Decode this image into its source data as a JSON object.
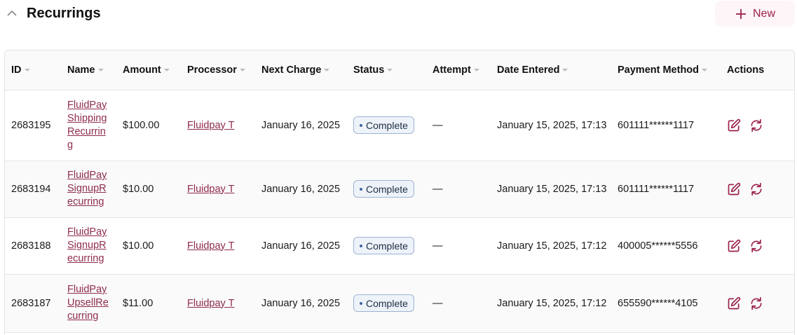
{
  "section": {
    "title": "Recurrings",
    "new_label": "New",
    "collapse_icon": "chevron-up-icon",
    "new_icon": "plus-icon"
  },
  "colors": {
    "accent": "#9b2048",
    "link": "#8e2c4c",
    "badge_border": "#9db3d3",
    "badge_bg": "#eef3fa"
  },
  "table": {
    "columns": [
      "ID",
      "Name",
      "Amount",
      "Processor",
      "Next Charge",
      "Status",
      "Attempt",
      "Date Entered",
      "Payment Method",
      "Actions"
    ],
    "rows": [
      {
        "id": "2683195",
        "name": "FluidPay Shipping Recurring",
        "amount": "$100.00",
        "processor": "Fluidpay T",
        "next_charge": "January 16, 2025",
        "status": "Complete",
        "attempt": "—",
        "date_entered": "January 15, 2025, 17:13",
        "payment_method": "601111******1117"
      },
      {
        "id": "2683194",
        "name": "FluidPay SignupRecurring",
        "amount": "$10.00",
        "processor": "Fluidpay T",
        "next_charge": "January 16, 2025",
        "status": "Complete",
        "attempt": "—",
        "date_entered": "January 15, 2025, 17:13",
        "payment_method": "601111******1117"
      },
      {
        "id": "2683188",
        "name": "FluidPay SignupRecurring",
        "amount": "$10.00",
        "processor": "Fluidpay T",
        "next_charge": "January 16, 2025",
        "status": "Complete",
        "attempt": "—",
        "date_entered": "January 15, 2025, 17:12",
        "payment_method": "400005******5556"
      },
      {
        "id": "2683187",
        "name": "FluidPay UpsellRecurring",
        "amount": "$11.00",
        "processor": "Fluidpay T",
        "next_charge": "January 16, 2025",
        "status": "Complete",
        "attempt": "—",
        "date_entered": "January 15, 2025, 17:12",
        "payment_method": "655590******4105"
      }
    ],
    "row_actions": [
      "edit-icon",
      "refresh-icon"
    ]
  }
}
